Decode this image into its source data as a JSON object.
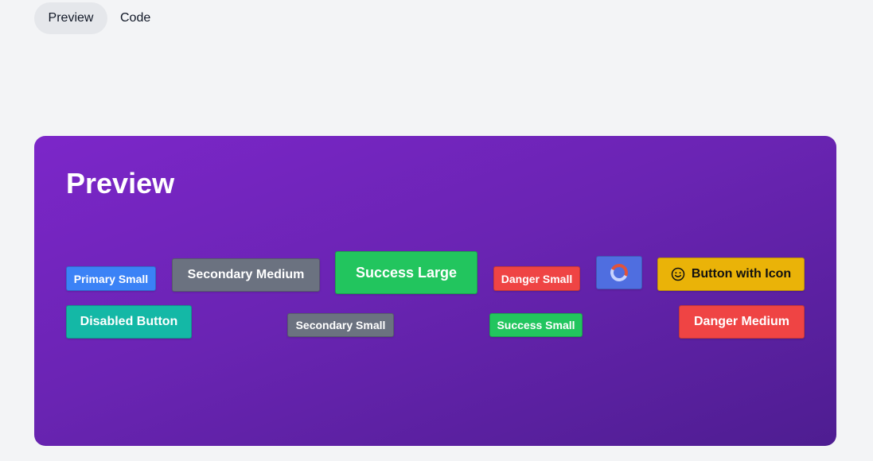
{
  "tabs": {
    "preview": "Preview",
    "code": "Code"
  },
  "card": {
    "title": "Preview"
  },
  "buttons": {
    "primary_small": "Primary Small",
    "secondary_medium": "Secondary Medium",
    "success_large": "Success Large",
    "danger_small": "Danger Small",
    "loading_icon": "spinner-icon",
    "icon_button": "Button with Icon",
    "icon_button_icon": "smile-icon",
    "disabled": "Disabled Button",
    "secondary_small": "Secondary Small",
    "success_small": "Success Small",
    "danger_medium": "Danger Medium"
  },
  "colors": {
    "page_bg": "#f3f4f6",
    "card_gradient_start": "#7c26c9",
    "card_gradient_end": "#4e1d91",
    "primary": "#3b82f6",
    "secondary": "#6b7280",
    "success": "#22c55e",
    "danger": "#ef4444",
    "warning": "#eab308",
    "teal": "#14b8a6",
    "loading": "#4f6ee0"
  }
}
